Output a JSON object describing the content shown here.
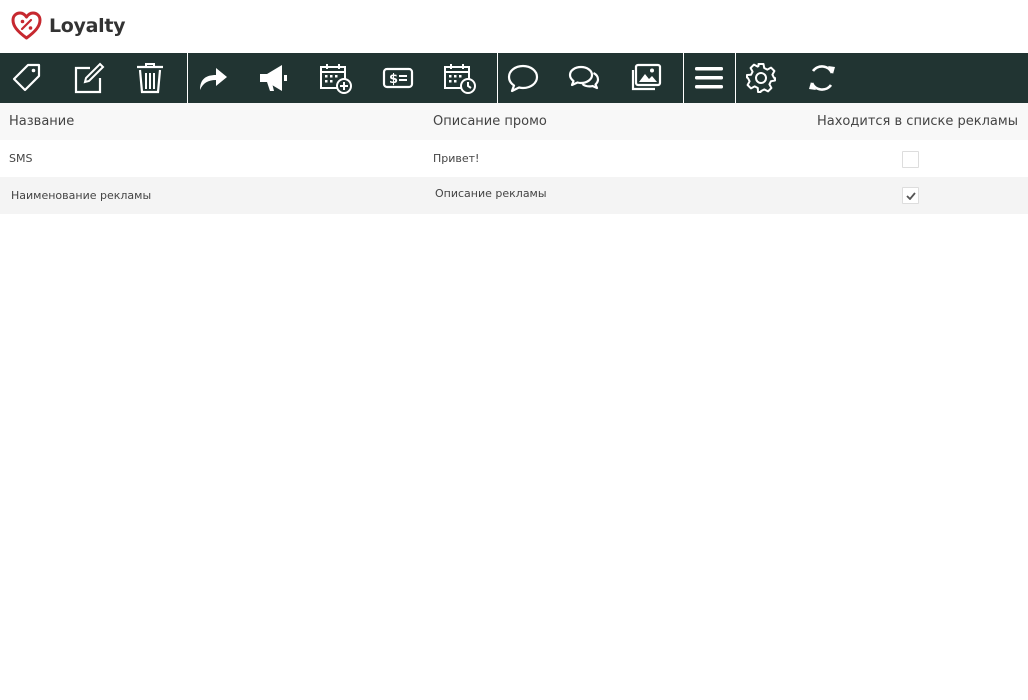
{
  "app": {
    "title": "Loyalty",
    "logo_icon": "heart-percent-icon",
    "brand_color": "#c6282f"
  },
  "toolbar": {
    "background": "#213432",
    "buttons": [
      {
        "icon": "tag-icon"
      },
      {
        "icon": "edit-icon"
      },
      {
        "icon": "trash-icon"
      },
      {
        "icon": "share-arrow-icon"
      },
      {
        "icon": "megaphone-icon"
      },
      {
        "icon": "calendar-add-icon"
      },
      {
        "icon": "money-icon"
      },
      {
        "icon": "calendar-clock-icon"
      },
      {
        "icon": "chat-bubble-icon"
      },
      {
        "icon": "chat-bubbles-icon"
      },
      {
        "icon": "images-icon"
      },
      {
        "icon": "menu-icon"
      },
      {
        "icon": "gear-icon"
      },
      {
        "icon": "refresh-icon"
      }
    ]
  },
  "table": {
    "columns": [
      "Название",
      "Описание промо",
      "Находится в списке рекламы"
    ],
    "rows": [
      {
        "name": "SMS",
        "description": "Привет!",
        "in_ad_list": false
      },
      {
        "name": "Наименование рекламы",
        "description": "Описание рекламы",
        "in_ad_list": true
      }
    ]
  }
}
